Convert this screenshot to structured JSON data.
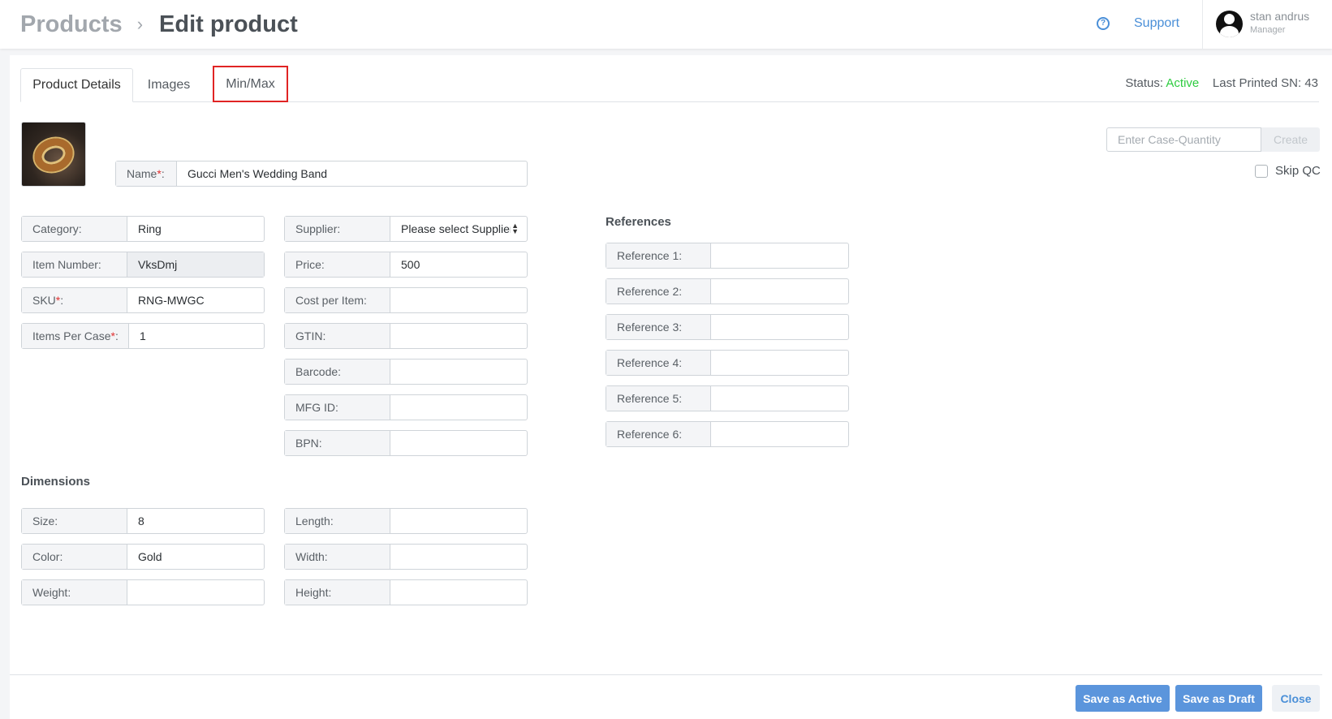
{
  "header": {
    "breadcrumb_parent": "Products",
    "breadcrumb_separator": "›",
    "breadcrumb_current": "Edit product",
    "help_icon": "?",
    "support_label": "Support",
    "user_name": "stan andrus",
    "user_role": "Manager"
  },
  "tabs": [
    {
      "label": "Product Details",
      "active": true
    },
    {
      "label": "Images",
      "active": false
    },
    {
      "label": "Min/Max",
      "active": false
    }
  ],
  "status": {
    "status_label": "Status:",
    "status_value": "Active",
    "status_color": "#2ecc40",
    "last_printed_label": "Last Printed SN:",
    "last_printed_value": "43"
  },
  "case_quantity": {
    "placeholder": "Enter Case-Quantity",
    "create_label": "Create"
  },
  "skip_qc_label": "Skip QC",
  "name": {
    "label": "Name",
    "required_mark": "*",
    "suffix": ":",
    "value": "Gucci Men's Wedding Band"
  },
  "left_fields": [
    {
      "label": "Category:",
      "value": "Ring"
    },
    {
      "label": "Item Number:",
      "value": "VksDmj"
    },
    {
      "label": "SKU",
      "required_mark": "*",
      "suffix": ":",
      "value": "RNG-MWGC"
    },
    {
      "label": "Items Per Case",
      "required_mark": "*",
      "suffix": ":",
      "value": "1"
    }
  ],
  "middle_fields": [
    {
      "label": "Supplier:",
      "value": "Please select Supplier"
    },
    {
      "label": "Price:",
      "value": "500"
    },
    {
      "label": "Cost per Item:",
      "value": ""
    },
    {
      "label": "GTIN:",
      "value": ""
    },
    {
      "label": "Barcode:",
      "value": ""
    },
    {
      "label": "MFG ID:",
      "value": ""
    },
    {
      "label": "BPN:",
      "value": ""
    }
  ],
  "references": {
    "title": "References",
    "fields": [
      {
        "label": "Reference 1:",
        "value": ""
      },
      {
        "label": "Reference 2:",
        "value": ""
      },
      {
        "label": "Reference 3:",
        "value": ""
      },
      {
        "label": "Reference 4:",
        "value": ""
      },
      {
        "label": "Reference 5:",
        "value": ""
      },
      {
        "label": "Reference 6:",
        "value": ""
      }
    ]
  },
  "dimensions": {
    "title": "Dimensions",
    "left": [
      {
        "label": "Size:",
        "value": "8"
      },
      {
        "label": "Color:",
        "value": "Gold"
      },
      {
        "label": "Weight:",
        "value": ""
      }
    ],
    "right": [
      {
        "label": "Length:",
        "value": ""
      },
      {
        "label": "Width:",
        "value": ""
      },
      {
        "label": "Height:",
        "value": ""
      }
    ]
  },
  "footer": {
    "save_active_label": "Save as Active",
    "save_draft_label": "Save as Draft",
    "close_label": "Close"
  }
}
